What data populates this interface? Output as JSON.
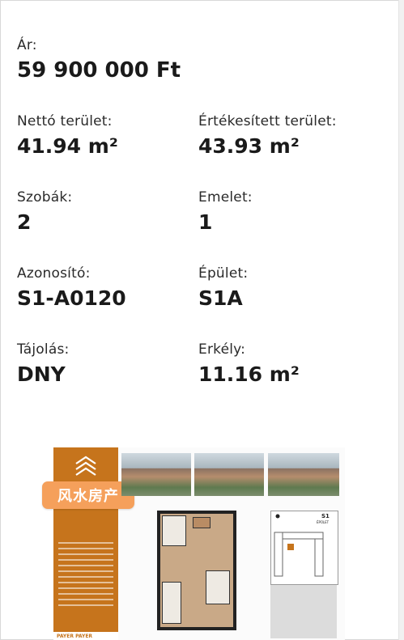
{
  "price": {
    "label": "Ár:",
    "value": "59 900 000 Ft"
  },
  "specs": [
    [
      {
        "label": "Nettó terület:",
        "value": "41.94 m²"
      },
      {
        "label": "Értékesített terület:",
        "value": "43.93 m²"
      }
    ],
    [
      {
        "label": "Szobák:",
        "value": "2"
      },
      {
        "label": "Emelet:",
        "value": "1"
      }
    ],
    [
      {
        "label": "Azonosító:",
        "value": "S1-A0120"
      },
      {
        "label": "Épület:",
        "value": "S1A"
      }
    ],
    [
      {
        "label": "Tájolás:",
        "value": "DNY"
      },
      {
        "label": "Erkély:",
        "value": "11.16 m²"
      }
    ]
  ],
  "brochure": {
    "watermark": "风水房产",
    "building_code": "S1",
    "building_label": "ÉPÜLET",
    "footer": "PAYER PAYER"
  }
}
